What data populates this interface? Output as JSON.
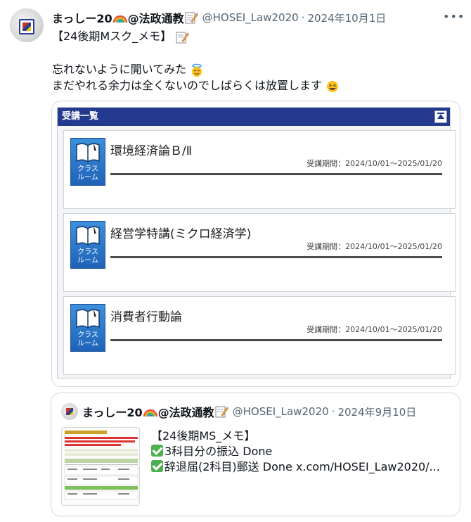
{
  "tweet": {
    "display_name": "まっしー20",
    "display_name_suffix": "@法政通教",
    "handle": "@HOSEI_Law2020",
    "separator": "·",
    "date": "2024年10月1日",
    "text_line1": "【24後期Mスク_メモ】",
    "text_line2": "忘れないように開いてみた",
    "text_line3": "まだやれる余力は全くないのでしばらくは放置します"
  },
  "icons": [
    "avatar",
    "rainbow-emoji-icon",
    "memo-emoji-icon",
    "innocent-emoji-icon",
    "grinning-squint-emoji-icon",
    "more-icon",
    "collapse-icon",
    "book-icon",
    "check-icon"
  ],
  "media": {
    "panel_title": "受講一覧",
    "courses": [
      {
        "title": "環境経済論Ｂ/Ⅱ",
        "period": "受講期間：2024/10/01～2025/01/20",
        "icon_label": "クラス\nルーム"
      },
      {
        "title": "経営学特講(ミクロ経済学)",
        "period": "受講期間：2024/10/01～2025/01/20",
        "icon_label": "クラス\nルーム"
      },
      {
        "title": "消費者行動論",
        "period": "受講期間：2024/10/01～2025/01/20",
        "icon_label": "クラス\nルーム"
      }
    ]
  },
  "quote": {
    "display_name": "まっしー20",
    "display_name_suffix": "@法政通教",
    "handle": "@HOSEI_Law2020",
    "separator": "·",
    "date": "2024年9月10日",
    "text_line1": "【24後期MS_メモ】",
    "text_line2": "3科目分の振込 Done",
    "text_line3": "辞退届(2科目)郵送 Done  x.com/HOSEI_Law2020/..."
  },
  "colors": {
    "panel_header": "#233a8e",
    "text": "#0f1419",
    "muted": "#536471",
    "border": "#cfd9de",
    "check": "#4caf50"
  }
}
